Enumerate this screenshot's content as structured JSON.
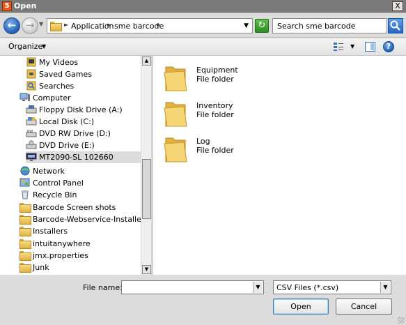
{
  "window": {
    "title": "Open",
    "app_icon_label": "5",
    "close_label": "X"
  },
  "address": {
    "crumbs": [
      "Application",
      "sme barcode"
    ],
    "search_placeholder": "Search sme barcode"
  },
  "toolbar": {
    "organize_label": "Organize"
  },
  "nav": {
    "items": [
      {
        "label": "My Videos",
        "icon": "videos-folder-icon"
      },
      {
        "label": "Saved Games",
        "icon": "saved-games-folder-icon"
      },
      {
        "label": "Searches",
        "icon": "searches-folder-icon"
      },
      {
        "label": "Computer",
        "icon": "computer-icon"
      },
      {
        "label": "Floppy Disk Drive (A:)",
        "icon": "floppy-drive-icon"
      },
      {
        "label": "Local Disk (C:)",
        "icon": "local-disk-icon"
      },
      {
        "label": "DVD RW Drive (D:)",
        "icon": "dvd-rw-drive-icon"
      },
      {
        "label": "DVD Drive (E:)",
        "icon": "dvd-drive-icon"
      },
      {
        "label": "MT2090-SL 102660",
        "icon": "network-drive-icon",
        "selected": true
      },
      {
        "label": "Network",
        "icon": "network-icon"
      },
      {
        "label": "Control Panel",
        "icon": "control-panel-icon"
      },
      {
        "label": "Recycle Bin",
        "icon": "recycle-bin-icon"
      },
      {
        "label": "Barcode Screen shots",
        "icon": "folder-icon"
      },
      {
        "label": "Barcode-Webservice-Installers",
        "icon": "folder-icon"
      },
      {
        "label": "Installers",
        "icon": "folder-icon"
      },
      {
        "label": "intuitanywhere",
        "icon": "folder-icon"
      },
      {
        "label": "jmx.properties",
        "icon": "folder-icon"
      },
      {
        "label": "Junk",
        "icon": "folder-icon"
      }
    ]
  },
  "files": [
    {
      "name": "Equipment",
      "type": "File folder"
    },
    {
      "name": "Inventory",
      "type": "File folder"
    },
    {
      "name": "Log",
      "type": "File folder"
    }
  ],
  "footer": {
    "file_name_label": "File name:",
    "file_name_value": "",
    "file_type_selected": "CSV Files (*.csv)",
    "open_label": "Open",
    "cancel_label": "Cancel"
  }
}
